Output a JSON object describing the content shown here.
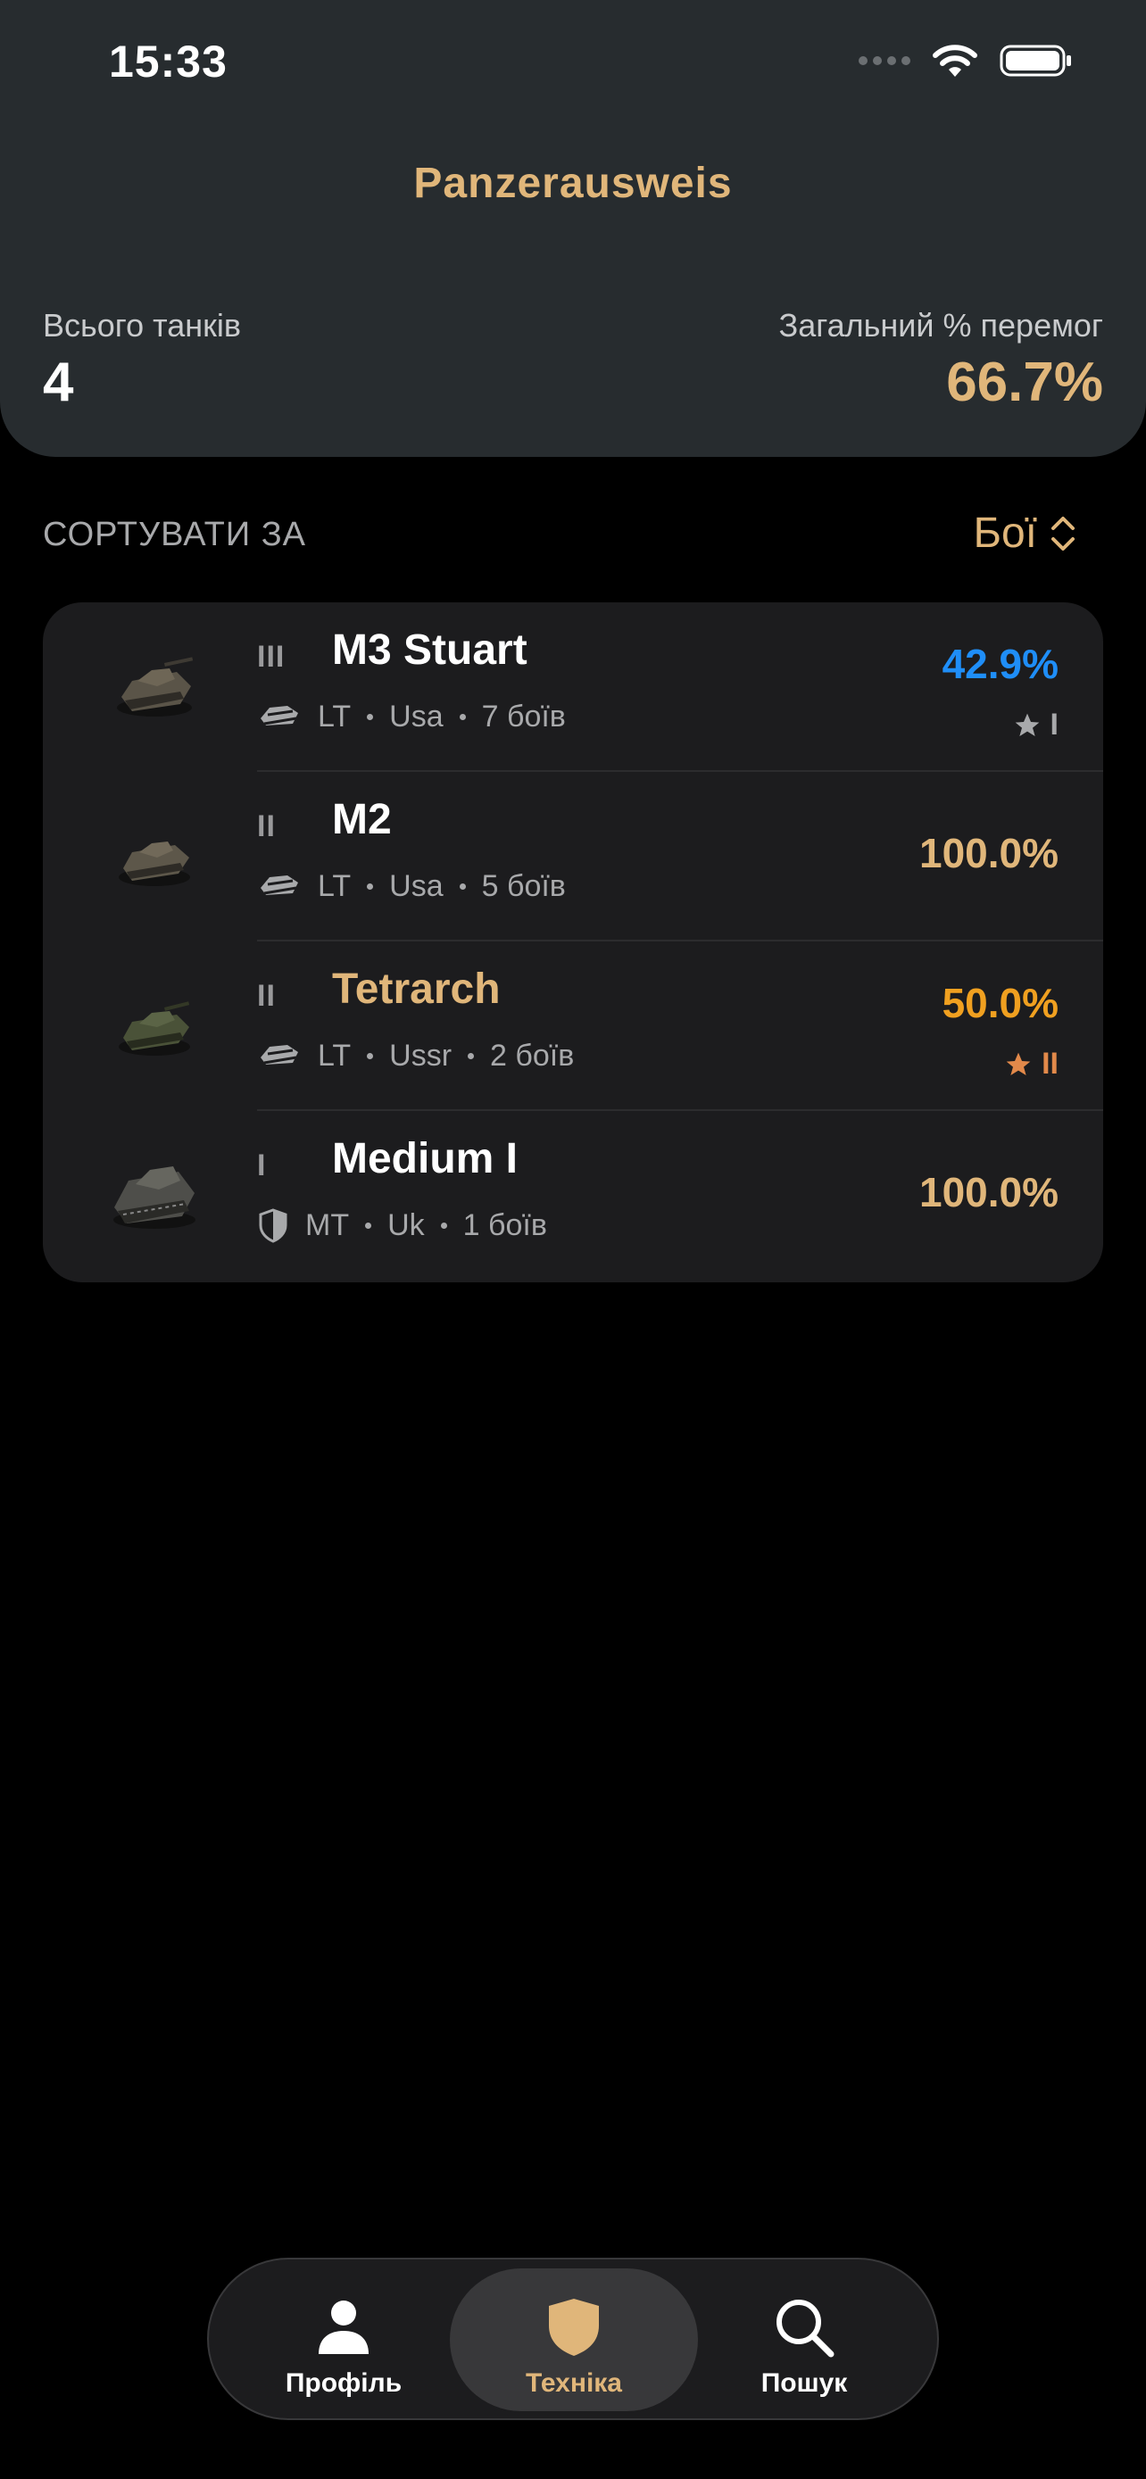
{
  "status_bar": {
    "time": "15:33"
  },
  "header": {
    "title": "Panzerausweis",
    "total_label": "Всього танків",
    "total_value": "4",
    "winrate_label": "Загальний % перемог",
    "winrate_value": "66.7%"
  },
  "sort": {
    "label": "СОРТУВАТИ ЗА",
    "value": "Бої"
  },
  "tanks": [
    {
      "tier": "III",
      "name": "M3 Stuart",
      "class": "LT",
      "nation": "Usa",
      "battles": "7 боїв",
      "winrate": "42.9%",
      "winrate_color": "#1f8ef8",
      "mastery": "I",
      "mastery_color": "#a8a9ab",
      "name_color": "#ffffff"
    },
    {
      "tier": "II",
      "name": "M2",
      "class": "LT",
      "nation": "Usa",
      "battles": "5 боїв",
      "winrate": "100.0%",
      "winrate_color": "#e0b67a",
      "mastery": "",
      "mastery_color": "",
      "name_color": "#ffffff"
    },
    {
      "tier": "II",
      "name": "Tetrarch",
      "class": "LT",
      "nation": "Ussr",
      "battles": "2 боїв",
      "winrate": "50.0%",
      "winrate_color": "#f0a020",
      "mastery": "II",
      "mastery_color": "#e2894a",
      "name_color": "#e0b67a"
    },
    {
      "tier": "I",
      "name": "Medium I",
      "class": "MT",
      "nation": "Uk",
      "battles": "1 боїв",
      "winrate": "100.0%",
      "winrate_color": "#e0b67a",
      "mastery": "",
      "mastery_color": "",
      "name_color": "#ffffff"
    }
  ],
  "tabbar": {
    "tabs": [
      {
        "label": "Профіль",
        "icon": "person-icon"
      },
      {
        "label": "Техніка",
        "icon": "shield-icon"
      },
      {
        "label": "Пошук",
        "icon": "search-icon"
      }
    ],
    "active": "Техніка"
  }
}
